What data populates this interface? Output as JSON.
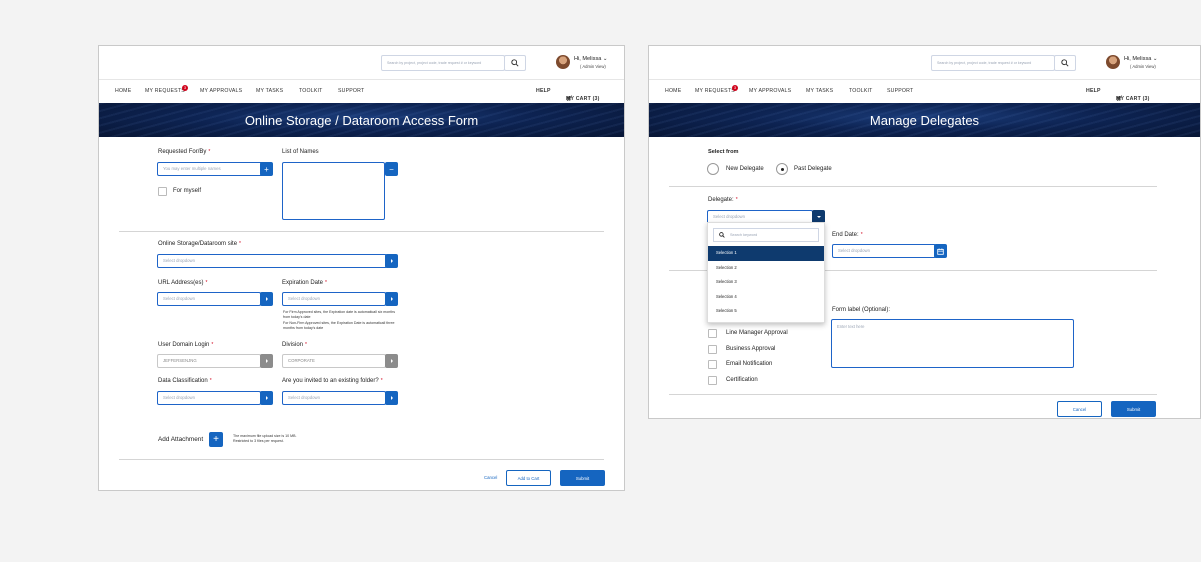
{
  "header": {
    "search_placeholder": "Search by project, project code, trade request # or keyword",
    "greeting": "Hi, Melissa",
    "role": "( Admin View)"
  },
  "nav": {
    "home": "HOME",
    "my_requests": "MY REQUESTS",
    "requests_badge": "3",
    "my_approvals": "MY APPROVALS",
    "my_tasks": "MY TASKS",
    "toolkit": "TOOLKIT",
    "support": "SUPPORT",
    "help": "HELP",
    "cart": "MY CART (3)"
  },
  "access_form": {
    "title": "Online Storage / Dataroom Access Form",
    "requested_for_label": "Requested For/By",
    "requested_for_placeholder": "You may enter multiple names",
    "list_of_names_label": "List of Names",
    "for_myself_label": "For myself",
    "site_label": "Online Storage/Dataroom site",
    "site_placeholder": "Select dropdown",
    "url_label": "URL Address(es)",
    "url_placeholder": "Select dropdown",
    "expiration_label": "Expiration Date",
    "expiration_placeholder": "Select dropdown",
    "expiration_note_1": "For Firm Approved sites, the Expiration date is automaticall six months from today's date",
    "expiration_note_2": "For Non-Firm Approved sites, the Expiration Date is automaticall three months from today's date",
    "login_label": "User Domain Login",
    "login_value": "JEFFERSENJNG",
    "division_label": "Division",
    "division_value": "CORPORATE",
    "classification_label": "Data Classification",
    "classification_placeholder": "Select dropdown",
    "invited_label": "Are you invited to an existing folder?",
    "invited_placeholder": "Select dropdown",
    "attachment_label": "Add Attachment",
    "attachment_note_1": "The maximum file upload size is 10 MB.",
    "attachment_note_2": "Restricted to 3 files per request.",
    "cancel": "Cancel",
    "add_to_cart": "Add to Cart",
    "submit": "Submit"
  },
  "delegates": {
    "title": "Manage Delegates",
    "select_from_label": "Select from",
    "new_delegate": "New Delegate",
    "past_delegate": "Past Delegate",
    "delegate_label": "Delegate:",
    "delegate_placeholder": "Select dropdown",
    "search_placeholder": "Search keyword",
    "options": [
      "Selection 1",
      "Selection 2",
      "Selection 3",
      "Selection 4",
      "Selection 5"
    ],
    "end_date_label": "End Date:",
    "end_date_placeholder": "Select dropdown",
    "form_label_label": "Form label (Optional):",
    "form_label_placeholder": "Enter text here",
    "approvals": [
      "Line Manager Approval",
      "Business Approval",
      "Email Notification",
      "Certification"
    ],
    "cancel": "Cancel",
    "submit": "Submit"
  },
  "colors": {
    "primary": "#1565c0",
    "banner": "#0d2352",
    "selected_option": "#0e3a6e",
    "required": "#d0021b"
  }
}
